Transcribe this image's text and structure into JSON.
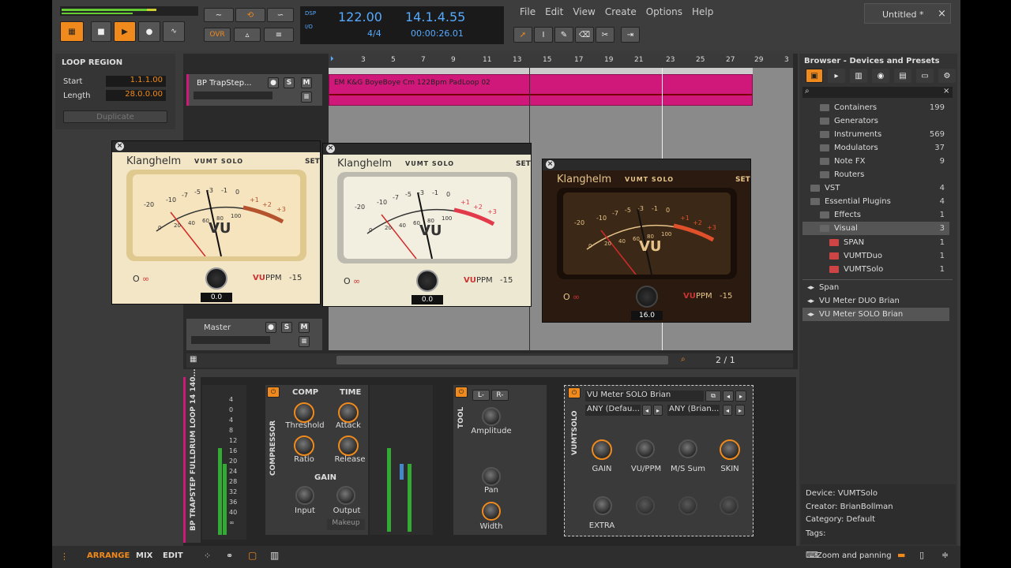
{
  "toolbar": {
    "mode_label": "OVR",
    "tempo": "122.00",
    "position": "14.1.4.55",
    "time_sig": "4/4",
    "time": "00:00:26.01",
    "dsp": "DSP",
    "io": "I/O"
  },
  "menu": [
    "File",
    "Edit",
    "View",
    "Create",
    "Options",
    "Help"
  ],
  "tab": {
    "title": "Untitled *",
    "close": "×"
  },
  "loop_region": {
    "title": "LOOP REGION",
    "start_label": "Start",
    "start": "1.1.1.00",
    "length_label": "Length",
    "length": "28.0.0.00",
    "duplicate": "Duplicate"
  },
  "ruler": [
    "3",
    "5",
    "7",
    "9",
    "11",
    "13",
    "15",
    "17",
    "19",
    "21",
    "23",
    "25",
    "27",
    "29",
    "3"
  ],
  "tracks": {
    "track1": "BP TrapStep...",
    "master": "Master",
    "clip": "EM K&G BoyeBoye Cm 122Bpm PadLoop 02",
    "s": "S",
    "m": "M"
  },
  "arrange_bar": {
    "zoom": "2 / 1"
  },
  "plugins": [
    {
      "brand": "Klanghelm",
      "model": "VUMT SOLO",
      "set": "SET",
      "vu": "VU",
      "ppm": "PPM",
      "level": "-15",
      "value": "0.0",
      "scale": [
        "-20",
        "-10",
        "-7",
        "-5",
        "-3",
        "-1",
        "0",
        "+1",
        "+2",
        "+3"
      ],
      "scale2": [
        "0",
        "20",
        "40",
        "60",
        "80",
        "100"
      ]
    },
    {
      "brand": "Klanghelm",
      "model": "VUMT SOLO",
      "set": "SET",
      "vu": "VU",
      "ppm": "PPM",
      "level": "-15",
      "value": "0.0",
      "scale": [
        "-20",
        "-10",
        "-7",
        "-5",
        "-3",
        "-1",
        "0",
        "+1",
        "+2",
        "+3"
      ],
      "scale2": [
        "0",
        "20",
        "40",
        "60",
        "80",
        "100"
      ]
    },
    {
      "brand": "Klanghelm",
      "model": "VUMT SOLO",
      "set": "SET",
      "vu": "VU",
      "ppm": "PPM",
      "level": "-15",
      "value": "16.0",
      "scale": [
        "-20",
        "-10",
        "-7",
        "-5",
        "-3",
        "-1",
        "0",
        "+1",
        "+2",
        "+3"
      ],
      "scale2": [
        "0",
        "20",
        "40",
        "60",
        "80",
        "100"
      ]
    }
  ],
  "browser": {
    "title": "Browser - Devices and Presets",
    "items": [
      {
        "label": "Containers",
        "count": "199"
      },
      {
        "label": "Generators",
        "count": ""
      },
      {
        "label": "Instruments",
        "count": "569"
      },
      {
        "label": "Modulators",
        "count": "37"
      },
      {
        "label": "Note FX",
        "count": "9"
      },
      {
        "label": "Routers",
        "count": ""
      },
      {
        "label": "VST",
        "count": "4"
      },
      {
        "label": "Essential Plugins",
        "count": "4"
      },
      {
        "label": "Effects",
        "count": "1"
      },
      {
        "label": "Visual",
        "count": "3"
      },
      {
        "label": "SPAN",
        "count": "1"
      },
      {
        "label": "VUMTDuo",
        "count": "1"
      },
      {
        "label": "VUMTSolo",
        "count": "1"
      }
    ],
    "presets": [
      "Span",
      "VU Meter DUO Brian",
      "VU Meter SOLO Brian"
    ],
    "info": {
      "device": "Device: VUMTSolo",
      "creator": "Creator: BrianBollman",
      "category": "Category: Default",
      "tags": "Tags:"
    },
    "zoom_panning": "Zoom and panning"
  },
  "devices": {
    "track_name": "BP TRAPSTEP FULLDRUM LOOP 14 140...",
    "compressor": {
      "title": "COMPRESSOR",
      "comp": "COMP",
      "time": "TIME",
      "threshold": "Threshold",
      "attack": "Attack",
      "ratio": "Ratio",
      "release": "Release",
      "gain": "GAIN",
      "input": "Input",
      "output": "Output",
      "makeup": "Makeup"
    },
    "tool": {
      "title": "TOOL",
      "l": "L-",
      "r": "R-",
      "amplitude": "Amplitude",
      "pan": "Pan",
      "width": "Width"
    },
    "vumtsolo": {
      "title": "VUMTSOLO",
      "preset": "VU Meter SOLO Brian",
      "any1": "ANY (Defau...",
      "any2": "ANY (Brian...",
      "gain": "GAIN",
      "vuppm": "VU/PPM",
      "ms": "M/S Sum",
      "skin": "SKIN",
      "extra": "EXTRA"
    },
    "meter_scale": [
      "4",
      "0",
      "4",
      "8",
      "12",
      "16",
      "20",
      "24",
      "28",
      "32",
      "36",
      "40",
      "∞"
    ]
  },
  "bottom_bar": {
    "arrange": "ARRANGE",
    "mix": "MIX",
    "edit": "EDIT"
  }
}
